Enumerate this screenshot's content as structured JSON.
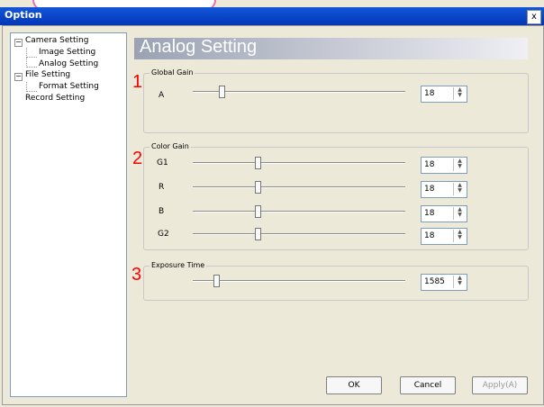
{
  "window": {
    "title": "Option",
    "close_label": "x"
  },
  "tree": {
    "items": [
      {
        "label": "Camera Setting"
      },
      {
        "label": "Image Setting"
      },
      {
        "label": "Analog Setting"
      },
      {
        "label": "File Setting"
      },
      {
        "label": "Format Setting"
      },
      {
        "label": "Record Setting"
      }
    ],
    "expanders": [
      "−",
      "−"
    ]
  },
  "page": {
    "title": "Analog Setting"
  },
  "sections": [
    {
      "number": "1",
      "legend": "Global Gain",
      "rows": [
        {
          "label": "A",
          "value": "18",
          "slider_percent": 13
        }
      ]
    },
    {
      "number": "2",
      "legend": "Color Gain",
      "rows": [
        {
          "label": "G1",
          "value": "18",
          "slider_percent": 30
        },
        {
          "label": "R",
          "value": "18",
          "slider_percent": 30
        },
        {
          "label": "B",
          "value": "18",
          "slider_percent": 30
        },
        {
          "label": "G2",
          "value": "18",
          "slider_percent": 30
        }
      ]
    },
    {
      "number": "3",
      "legend": "Exposure Time",
      "rows": [
        {
          "label": "",
          "value": "1585",
          "slider_percent": 10
        }
      ]
    }
  ],
  "buttons": {
    "ok": "OK",
    "cancel": "Cancel",
    "apply": "Apply(A)"
  },
  "colors": {
    "marker_red": "#ff0000",
    "titlebar_blue": "#0a47c8",
    "pink_outline": "#e46fb0"
  }
}
